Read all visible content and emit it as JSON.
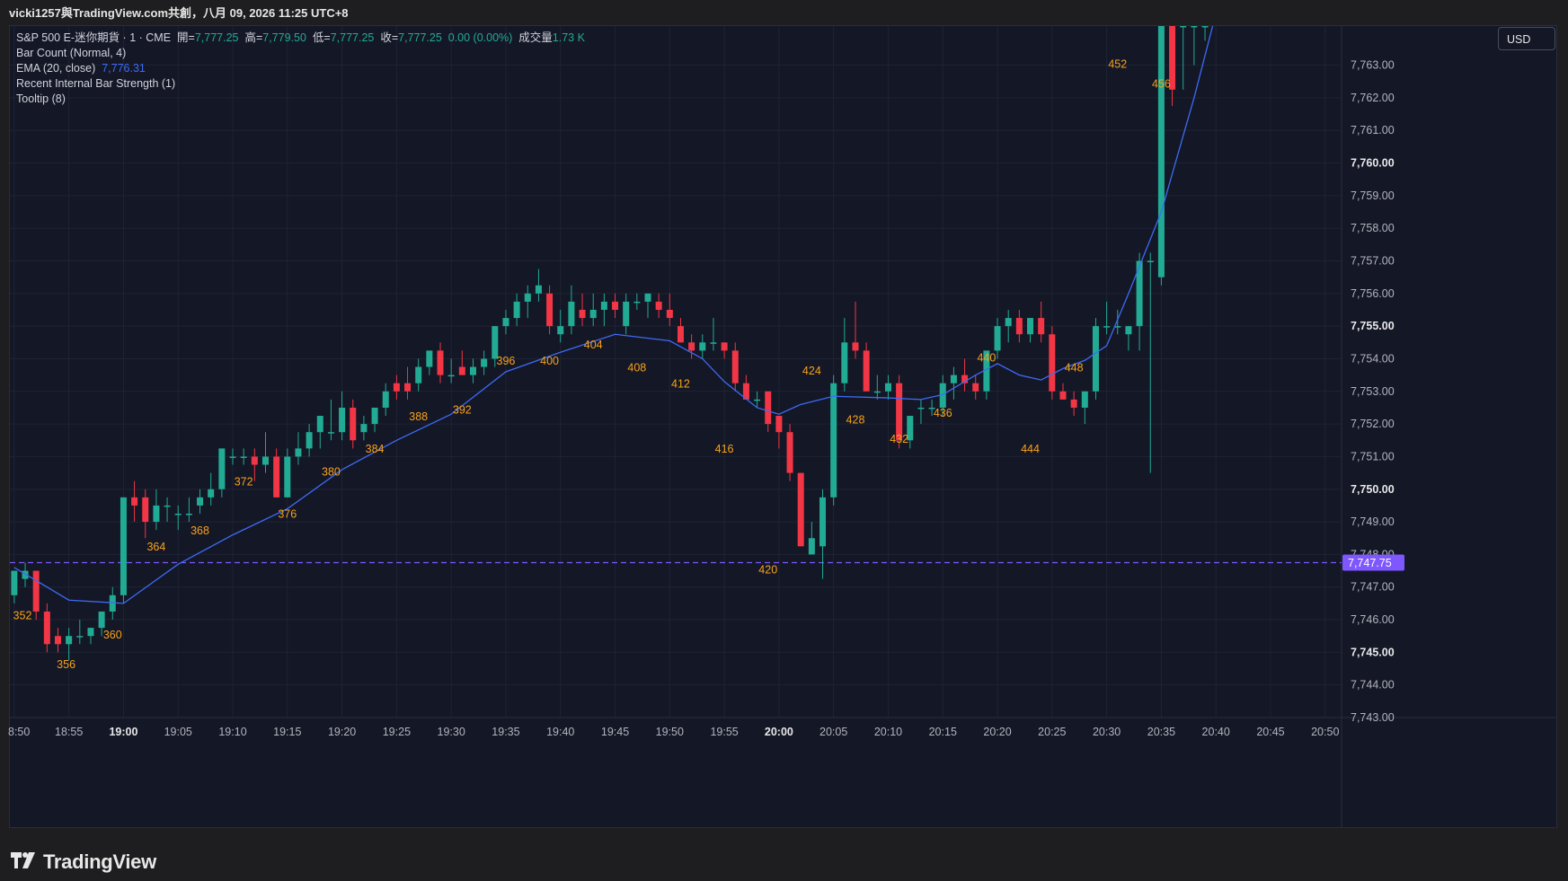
{
  "header": {
    "text": "vicki1257與TradingView.com共創，八月 09, 2026 11:25 UTC+8"
  },
  "legend": {
    "symbol": "S&P 500 E-迷你期貨 · 1 · CME",
    "open_label": "開=",
    "open": "7,777.25",
    "high_label": "高=",
    "high": "7,779.50",
    "low_label": "低=",
    "low": "7,777.25",
    "close_label": "收=",
    "close": "7,777.25",
    "change": "0.00 (0.00%)",
    "volume_label": "成交量",
    "volume": "1.73 K",
    "indicator1": "Bar Count (Normal, 4)",
    "indicator2_label": "EMA (20, close)",
    "indicator2_value": "7,776.31",
    "indicator3": "Recent Internal Bar Strength (1)",
    "indicator4": "Tooltip (8)"
  },
  "currency_button": "USD",
  "brand": "TradingView",
  "colors": {
    "background": "#141726",
    "up": "#22ab94",
    "down": "#f23645",
    "ema": "#3d6bf5",
    "count_label": "#f7a21b",
    "price_line": "#7e57ff",
    "price_badge": "#7e57ff"
  },
  "chart_data": {
    "type": "candlestick",
    "title": "S&P 500 E-迷你期貨 · 1 · CME",
    "xlabel": "",
    "ylabel": "",
    "ylim": [
      7743.0,
      7764.2
    ],
    "y_ticks": [
      "7,743.00",
      "7,744.00",
      "7,745.00",
      "7,746.00",
      "7,747.00",
      "7,748.00",
      "7,749.00",
      "7,750.00",
      "7,751.00",
      "7,752.00",
      "7,753.00",
      "7,754.00",
      "7,755.00",
      "7,756.00",
      "7,757.00",
      "7,758.00",
      "7,759.00",
      "7,760.00",
      "7,761.00",
      "7,762.00",
      "7,763.00"
    ],
    "y_tick_values": [
      7743,
      7744,
      7745,
      7746,
      7747,
      7748,
      7749,
      7750,
      7751,
      7752,
      7753,
      7754,
      7755,
      7756,
      7757,
      7758,
      7759,
      7760,
      7761,
      7762,
      7763
    ],
    "bold_y_ticks": [
      7745,
      7750,
      7755,
      7760
    ],
    "x_ticks": [
      "8:50",
      "18:55",
      "19:00",
      "19:05",
      "19:10",
      "19:15",
      "19:20",
      "19:25",
      "19:30",
      "19:35",
      "19:40",
      "19:45",
      "19:50",
      "19:55",
      "20:00",
      "20:05",
      "20:10",
      "20:15",
      "20:20",
      "20:25",
      "20:30",
      "20:35",
      "20:40",
      "20:45",
      "20:50"
    ],
    "x_tick_minutes": [
      -10,
      -5,
      0,
      5,
      10,
      15,
      20,
      25,
      30,
      35,
      40,
      45,
      50,
      55,
      60,
      65,
      70,
      75,
      80,
      85,
      90,
      95,
      100,
      105,
      110
    ],
    "bold_x_ticks": [
      "19:00",
      "20:00"
    ],
    "x_minute_start": -10.4,
    "x_minute_end": 111.5,
    "current_price": 7747.75,
    "current_price_label": "7,747.75",
    "candles": [
      {
        "o": 7746.75,
        "h": 7747.25,
        "l": 7746.5,
        "c": 7747.5
      },
      {
        "o": 7747.25,
        "h": 7747.75,
        "l": 7747.0,
        "c": 7747.5
      },
      {
        "o": 7747.5,
        "h": 7747.5,
        "l": 7746.0,
        "c": 7746.25
      },
      {
        "o": 7746.25,
        "h": 7746.5,
        "l": 7745.0,
        "c": 7745.25
      },
      {
        "o": 7745.5,
        "h": 7745.75,
        "l": 7745.0,
        "c": 7745.25
      },
      {
        "o": 7745.25,
        "h": 7745.75,
        "l": 7744.75,
        "c": 7745.5
      },
      {
        "o": 7745.5,
        "h": 7746.0,
        "l": 7745.25,
        "c": 7745.5
      },
      {
        "o": 7745.5,
        "h": 7745.75,
        "l": 7745.25,
        "c": 7745.75
      },
      {
        "o": 7745.75,
        "h": 7746.25,
        "l": 7745.5,
        "c": 7746.25
      },
      {
        "o": 7746.25,
        "h": 7747.0,
        "l": 7746.0,
        "c": 7746.75
      },
      {
        "o": 7746.75,
        "h": 7749.75,
        "l": 7746.5,
        "c": 7749.75
      },
      {
        "o": 7749.75,
        "h": 7750.25,
        "l": 7749.0,
        "c": 7749.5
      },
      {
        "o": 7749.75,
        "h": 7750.0,
        "l": 7748.5,
        "c": 7749.0
      },
      {
        "o": 7749.0,
        "h": 7750.0,
        "l": 7748.75,
        "c": 7749.5
      },
      {
        "o": 7749.5,
        "h": 7749.75,
        "l": 7749.0,
        "c": 7749.5
      },
      {
        "o": 7749.25,
        "h": 7749.5,
        "l": 7748.75,
        "c": 7749.25
      },
      {
        "o": 7749.25,
        "h": 7749.75,
        "l": 7749.0,
        "c": 7749.25
      },
      {
        "o": 7749.5,
        "h": 7750.0,
        "l": 7749.25,
        "c": 7749.75
      },
      {
        "o": 7749.75,
        "h": 7750.5,
        "l": 7749.5,
        "c": 7750.0
      },
      {
        "o": 7750.0,
        "h": 7751.25,
        "l": 7749.75,
        "c": 7751.25
      },
      {
        "o": 7751.0,
        "h": 7751.25,
        "l": 7750.75,
        "c": 7751.0
      },
      {
        "o": 7751.0,
        "h": 7751.25,
        "l": 7750.75,
        "c": 7751.0
      },
      {
        "o": 7751.0,
        "h": 7751.25,
        "l": 7750.25,
        "c": 7750.75
      },
      {
        "o": 7750.75,
        "h": 7751.75,
        "l": 7750.5,
        "c": 7751.0
      },
      {
        "o": 7751.0,
        "h": 7751.25,
        "l": 7749.75,
        "c": 7749.75
      },
      {
        "o": 7749.75,
        "h": 7751.25,
        "l": 7749.75,
        "c": 7751.0
      },
      {
        "o": 7751.0,
        "h": 7751.75,
        "l": 7750.75,
        "c": 7751.25
      },
      {
        "o": 7751.25,
        "h": 7752.0,
        "l": 7751.0,
        "c": 7751.75
      },
      {
        "o": 7751.75,
        "h": 7752.25,
        "l": 7751.25,
        "c": 7752.25
      },
      {
        "o": 7751.75,
        "h": 7752.75,
        "l": 7751.5,
        "c": 7751.75
      },
      {
        "o": 7751.75,
        "h": 7753.0,
        "l": 7751.5,
        "c": 7752.5
      },
      {
        "o": 7752.5,
        "h": 7752.75,
        "l": 7751.25,
        "c": 7751.5
      },
      {
        "o": 7751.75,
        "h": 7752.25,
        "l": 7751.5,
        "c": 7752.0
      },
      {
        "o": 7752.0,
        "h": 7752.5,
        "l": 7751.75,
        "c": 7752.5
      },
      {
        "o": 7752.5,
        "h": 7753.25,
        "l": 7752.25,
        "c": 7753.0
      },
      {
        "o": 7753.25,
        "h": 7753.5,
        "l": 7752.75,
        "c": 7753.0
      },
      {
        "o": 7753.25,
        "h": 7753.75,
        "l": 7752.75,
        "c": 7753.0
      },
      {
        "o": 7753.25,
        "h": 7754.0,
        "l": 7753.0,
        "c": 7753.75
      },
      {
        "o": 7753.75,
        "h": 7754.25,
        "l": 7753.5,
        "c": 7754.25
      },
      {
        "o": 7754.25,
        "h": 7754.5,
        "l": 7753.25,
        "c": 7753.5
      },
      {
        "o": 7753.5,
        "h": 7754.0,
        "l": 7753.25,
        "c": 7753.5
      },
      {
        "o": 7753.75,
        "h": 7754.25,
        "l": 7753.5,
        "c": 7753.5
      },
      {
        "o": 7753.5,
        "h": 7754.0,
        "l": 7753.25,
        "c": 7753.75
      },
      {
        "o": 7753.75,
        "h": 7754.25,
        "l": 7753.5,
        "c": 7754.0
      },
      {
        "o": 7754.0,
        "h": 7755.0,
        "l": 7753.75,
        "c": 7755.0
      },
      {
        "o": 7755.0,
        "h": 7755.5,
        "l": 7754.75,
        "c": 7755.25
      },
      {
        "o": 7755.25,
        "h": 7756.0,
        "l": 7755.0,
        "c": 7755.75
      },
      {
        "o": 7755.75,
        "h": 7756.25,
        "l": 7755.25,
        "c": 7756.0
      },
      {
        "o": 7756.0,
        "h": 7756.75,
        "l": 7755.75,
        "c": 7756.25
      },
      {
        "o": 7756.0,
        "h": 7756.25,
        "l": 7754.75,
        "c": 7755.0
      },
      {
        "o": 7754.75,
        "h": 7755.5,
        "l": 7754.5,
        "c": 7755.0
      },
      {
        "o": 7755.0,
        "h": 7756.25,
        "l": 7754.75,
        "c": 7755.75
      },
      {
        "o": 7755.5,
        "h": 7756.0,
        "l": 7755.0,
        "c": 7755.25
      },
      {
        "o": 7755.25,
        "h": 7756.0,
        "l": 7755.0,
        "c": 7755.5
      },
      {
        "o": 7755.5,
        "h": 7756.0,
        "l": 7755.0,
        "c": 7755.75
      },
      {
        "o": 7755.75,
        "h": 7756.0,
        "l": 7755.25,
        "c": 7755.5
      },
      {
        "o": 7755.0,
        "h": 7756.0,
        "l": 7754.75,
        "c": 7755.75
      },
      {
        "o": 7755.75,
        "h": 7756.0,
        "l": 7755.5,
        "c": 7755.75
      },
      {
        "o": 7755.75,
        "h": 7756.0,
        "l": 7755.25,
        "c": 7756.0
      },
      {
        "o": 7755.75,
        "h": 7756.0,
        "l": 7755.25,
        "c": 7755.5
      },
      {
        "o": 7755.5,
        "h": 7756.0,
        "l": 7755.0,
        "c": 7755.25
      },
      {
        "o": 7755.0,
        "h": 7755.25,
        "l": 7754.5,
        "c": 7754.5
      },
      {
        "o": 7754.5,
        "h": 7754.75,
        "l": 7754.0,
        "c": 7754.25
      },
      {
        "o": 7754.25,
        "h": 7754.75,
        "l": 7754.0,
        "c": 7754.5
      },
      {
        "o": 7754.5,
        "h": 7755.25,
        "l": 7754.25,
        "c": 7754.5
      },
      {
        "o": 7754.5,
        "h": 7754.5,
        "l": 7754.0,
        "c": 7754.25
      },
      {
        "o": 7754.25,
        "h": 7754.5,
        "l": 7753.0,
        "c": 7753.25
      },
      {
        "o": 7753.25,
        "h": 7753.5,
        "l": 7752.75,
        "c": 7752.75
      },
      {
        "o": 7752.75,
        "h": 7753.0,
        "l": 7752.5,
        "c": 7752.75
      },
      {
        "o": 7753.0,
        "h": 7753.0,
        "l": 7751.75,
        "c": 7752.0
      },
      {
        "o": 7752.25,
        "h": 7752.25,
        "l": 7751.25,
        "c": 7751.75
      },
      {
        "o": 7751.75,
        "h": 7752.0,
        "l": 7750.25,
        "c": 7750.5
      },
      {
        "o": 7750.5,
        "h": 7750.5,
        "l": 7748.25,
        "c": 7748.25
      },
      {
        "o": 7748.0,
        "h": 7749.0,
        "l": 7748.0,
        "c": 7748.5
      },
      {
        "o": 7748.25,
        "h": 7750.0,
        "l": 7747.25,
        "c": 7749.75
      },
      {
        "o": 7749.75,
        "h": 7753.5,
        "l": 7749.5,
        "c": 7753.25
      },
      {
        "o": 7753.25,
        "h": 7755.25,
        "l": 7753.0,
        "c": 7754.5
      },
      {
        "o": 7754.5,
        "h": 7755.75,
        "l": 7754.0,
        "c": 7754.25
      },
      {
        "o": 7754.25,
        "h": 7754.5,
        "l": 7753.0,
        "c": 7753.0
      },
      {
        "o": 7753.0,
        "h": 7753.5,
        "l": 7752.75,
        "c": 7753.0
      },
      {
        "o": 7753.0,
        "h": 7753.5,
        "l": 7752.75,
        "c": 7753.25
      },
      {
        "o": 7753.25,
        "h": 7753.5,
        "l": 7751.25,
        "c": 7751.5
      },
      {
        "o": 7751.5,
        "h": 7752.25,
        "l": 7751.25,
        "c": 7752.25
      },
      {
        "o": 7752.5,
        "h": 7752.75,
        "l": 7752.0,
        "c": 7752.5
      },
      {
        "o": 7752.5,
        "h": 7752.75,
        "l": 7752.25,
        "c": 7752.5
      },
      {
        "o": 7752.5,
        "h": 7753.5,
        "l": 7752.25,
        "c": 7753.25
      },
      {
        "o": 7753.25,
        "h": 7753.75,
        "l": 7752.75,
        "c": 7753.5
      },
      {
        "o": 7753.5,
        "h": 7754.0,
        "l": 7753.0,
        "c": 7753.25
      },
      {
        "o": 7753.25,
        "h": 7753.5,
        "l": 7752.75,
        "c": 7753.0
      },
      {
        "o": 7753.0,
        "h": 7754.25,
        "l": 7752.75,
        "c": 7754.25
      },
      {
        "o": 7754.25,
        "h": 7755.25,
        "l": 7754.0,
        "c": 7755.0
      },
      {
        "o": 7755.0,
        "h": 7755.5,
        "l": 7754.5,
        "c": 7755.25
      },
      {
        "o": 7755.25,
        "h": 7755.5,
        "l": 7754.5,
        "c": 7754.75
      },
      {
        "o": 7754.75,
        "h": 7755.25,
        "l": 7754.5,
        "c": 7755.25
      },
      {
        "o": 7755.25,
        "h": 7755.75,
        "l": 7754.5,
        "c": 7754.75
      },
      {
        "o": 7754.75,
        "h": 7755.0,
        "l": 7752.75,
        "c": 7753.0
      },
      {
        "o": 7753.0,
        "h": 7753.25,
        "l": 7752.75,
        "c": 7752.75
      },
      {
        "o": 7752.75,
        "h": 7753.0,
        "l": 7752.25,
        "c": 7752.5
      },
      {
        "o": 7752.5,
        "h": 7753.0,
        "l": 7752.0,
        "c": 7753.0
      },
      {
        "o": 7753.0,
        "h": 7755.25,
        "l": 7752.75,
        "c": 7755.0
      },
      {
        "o": 7755.0,
        "h": 7755.75,
        "l": 7754.75,
        "c": 7755.0
      },
      {
        "o": 7755.0,
        "h": 7755.5,
        "l": 7754.75,
        "c": 7755.0
      },
      {
        "o": 7754.75,
        "h": 7755.0,
        "l": 7754.25,
        "c": 7755.0
      },
      {
        "o": 7755.0,
        "h": 7757.25,
        "l": 7754.25,
        "c": 7757.0
      },
      {
        "o": 7757.0,
        "h": 7757.25,
        "l": 7750.5,
        "c": 7757.0
      },
      {
        "o": 7756.5,
        "h": 7764.2,
        "l": 7756.25,
        "c": 7764.2
      },
      {
        "o": 7764.2,
        "h": 7764.2,
        "l": 7761.75,
        "c": 7762.25
      },
      {
        "o": 7764.2,
        "h": 7764.2,
        "l": 7762.25,
        "c": 7764.2
      },
      {
        "o": 7764.2,
        "h": 7764.2,
        "l": 7763.0,
        "c": 7764.2
      },
      {
        "o": 7764.2,
        "h": 7764.2,
        "l": 7763.75,
        "c": 7764.2
      }
    ],
    "ema": [
      {
        "m": -10,
        "v": 7747.6
      },
      {
        "m": -5,
        "v": 7746.6
      },
      {
        "m": 0,
        "v": 7746.5
      },
      {
        "m": 5,
        "v": 7747.7
      },
      {
        "m": 10,
        "v": 7748.6
      },
      {
        "m": 15,
        "v": 7749.4
      },
      {
        "m": 20,
        "v": 7750.6
      },
      {
        "m": 25,
        "v": 7751.5
      },
      {
        "m": 30,
        "v": 7752.3
      },
      {
        "m": 35,
        "v": 7753.6
      },
      {
        "m": 40,
        "v": 7754.2
      },
      {
        "m": 45,
        "v": 7754.75
      },
      {
        "m": 50,
        "v": 7754.55
      },
      {
        "m": 53,
        "v": 7754.0
      },
      {
        "m": 55,
        "v": 7753.3
      },
      {
        "m": 58,
        "v": 7752.5
      },
      {
        "m": 60,
        "v": 7752.3
      },
      {
        "m": 62,
        "v": 7752.6
      },
      {
        "m": 65,
        "v": 7752.85
      },
      {
        "m": 70,
        "v": 7752.8
      },
      {
        "m": 73,
        "v": 7752.75
      },
      {
        "m": 75,
        "v": 7752.9
      },
      {
        "m": 78,
        "v": 7753.5
      },
      {
        "m": 80,
        "v": 7753.85
      },
      {
        "m": 82,
        "v": 7753.5
      },
      {
        "m": 84,
        "v": 7753.35
      },
      {
        "m": 86,
        "v": 7753.7
      },
      {
        "m": 88,
        "v": 7753.95
      },
      {
        "m": 90,
        "v": 7754.4
      },
      {
        "m": 92,
        "v": 7756.0
      },
      {
        "m": 95,
        "v": 7758.5
      },
      {
        "m": 98,
        "v": 7762.0
      },
      {
        "m": 99.7,
        "v": 7764.2
      }
    ],
    "bar_counts": [
      {
        "label": "352",
        "m": -9.25,
        "v": 7746.02,
        "pos": "below"
      },
      {
        "label": "356",
        "m": -5.25,
        "v": 7744.52,
        "pos": "below"
      },
      {
        "label": "360",
        "m": -1.0,
        "v": 7745.42,
        "pos": "below"
      },
      {
        "label": "364",
        "m": 3.0,
        "v": 7748.12,
        "pos": "below"
      },
      {
        "label": "368",
        "m": 7.0,
        "v": 7748.62,
        "pos": "below"
      },
      {
        "label": "372",
        "m": 11.0,
        "v": 7750.12,
        "pos": "below"
      },
      {
        "label": "376",
        "m": 15.0,
        "v": 7749.12,
        "pos": "below"
      },
      {
        "label": "380",
        "m": 19.0,
        "v": 7750.42,
        "pos": "below"
      },
      {
        "label": "384",
        "m": 23.0,
        "v": 7751.12,
        "pos": "below"
      },
      {
        "label": "388",
        "m": 27.0,
        "v": 7752.12,
        "pos": "below"
      },
      {
        "label": "392",
        "m": 31.0,
        "v": 7752.32,
        "pos": "below"
      },
      {
        "label": "396",
        "m": 35.0,
        "v": 7753.82,
        "pos": "below"
      },
      {
        "label": "400",
        "m": 39.0,
        "v": 7753.82,
        "pos": "below"
      },
      {
        "label": "404",
        "m": 43.0,
        "v": 7754.32,
        "pos": "below"
      },
      {
        "label": "408",
        "m": 47.0,
        "v": 7753.62,
        "pos": "below"
      },
      {
        "label": "412",
        "m": 51.0,
        "v": 7753.12,
        "pos": "below"
      },
      {
        "label": "416",
        "m": 55.0,
        "v": 7751.12,
        "pos": "below"
      },
      {
        "label": "420",
        "m": 59.0,
        "v": 7747.42,
        "pos": "below"
      },
      {
        "label": "424",
        "m": 63.0,
        "v": 7753.52,
        "pos": "below"
      },
      {
        "label": "428",
        "m": 67.0,
        "v": 7752.02,
        "pos": "below"
      },
      {
        "label": "432",
        "m": 71.0,
        "v": 7751.42,
        "pos": "below"
      },
      {
        "label": "436",
        "m": 75.0,
        "v": 7752.22,
        "pos": "below"
      },
      {
        "label": "440",
        "m": 79.0,
        "v": 7753.92,
        "pos": "below"
      },
      {
        "label": "444",
        "m": 83.0,
        "v": 7751.12,
        "pos": "below"
      },
      {
        "label": "448",
        "m": 87.0,
        "v": 7753.62,
        "pos": "below"
      },
      {
        "label": "452",
        "m": 91.0,
        "v": 7762.92,
        "pos": "below"
      },
      {
        "label": "456",
        "m": 95.0,
        "v": 7762.32,
        "pos": "below"
      }
    ]
  }
}
